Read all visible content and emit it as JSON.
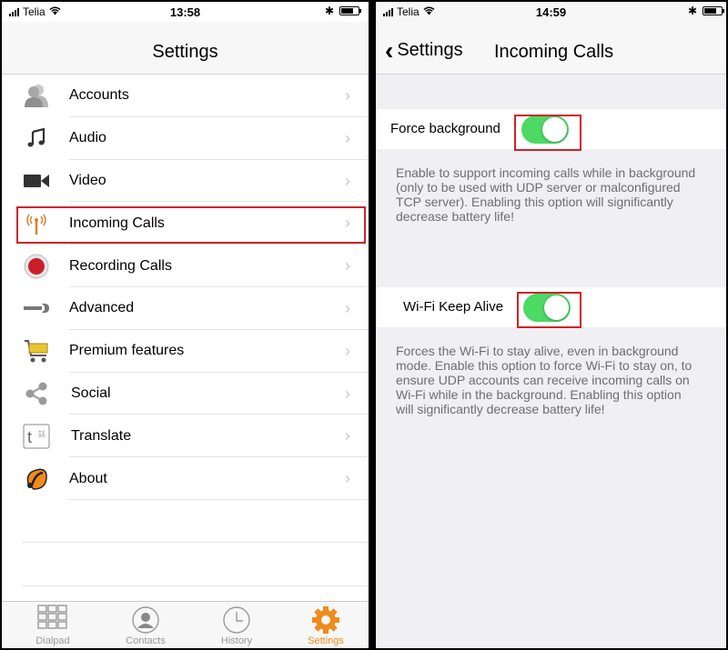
{
  "left": {
    "status": {
      "carrier": "Telia",
      "time": "13:58"
    },
    "title": "Settings",
    "items": [
      {
        "label": "Accounts",
        "icon": "accounts-icon"
      },
      {
        "label": "Audio",
        "icon": "music-note-icon"
      },
      {
        "label": "Video",
        "icon": "video-camera-icon"
      },
      {
        "label": "Incoming Calls",
        "icon": "antenna-icon"
      },
      {
        "label": "Recording Calls",
        "icon": "record-icon"
      },
      {
        "label": "Advanced",
        "icon": "wrench-icon"
      },
      {
        "label": "Premium features",
        "icon": "cart-icon"
      },
      {
        "label": "Social",
        "icon": "share-icon"
      },
      {
        "label": "Translate",
        "icon": "translate-icon"
      },
      {
        "label": "About",
        "icon": "about-icon"
      }
    ],
    "tabs": [
      {
        "label": "Dialpad",
        "icon": "dialpad-icon"
      },
      {
        "label": "Contacts",
        "icon": "contacts-icon"
      },
      {
        "label": "History",
        "icon": "clock-icon"
      },
      {
        "label": "Settings",
        "icon": "gear-icon",
        "active": true
      }
    ],
    "accent": "#f08a1c",
    "highlight_color": "#d0212a"
  },
  "right": {
    "status": {
      "carrier": "Telia",
      "time": "14:59"
    },
    "back_label": "Settings",
    "title": "Incoming Calls",
    "force_background": {
      "label": "Force background",
      "on": true,
      "description": "Enable to support incoming calls while in background (only to be used with UDP server or malconfigured TCP server). Enabling this option will significantly decrease battery life!"
    },
    "wifi_keep_alive": {
      "label": "Wi-Fi Keep Alive",
      "on": true,
      "description": "Forces the Wi-Fi to stay alive, even in background mode. Enable this option to force Wi-Fi to stay on, to ensure UDP accounts can receive incoming calls on Wi-Fi while in the background. Enabling this option will significantly decrease battery life!"
    },
    "toggle_color": "#4cd964"
  }
}
